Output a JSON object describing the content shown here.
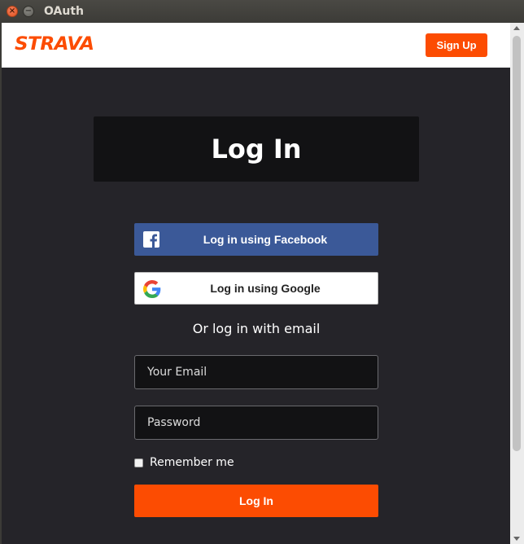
{
  "window": {
    "title": "OAuth",
    "close_glyph": "×",
    "minimize_glyph": "−"
  },
  "header": {
    "logo_text": "STRAVA",
    "signup_label": "Sign Up"
  },
  "main": {
    "heading": "Log In",
    "facebook_label": "Log in using Facebook",
    "google_label": "Log in using Google",
    "or_text": "Or log in with email",
    "email_placeholder": "Your Email",
    "password_placeholder": "Password",
    "remember_label": "Remember me",
    "login_label": "Log In"
  },
  "icons": {
    "facebook": "facebook-icon",
    "google": "google-icon"
  },
  "colors": {
    "brand_orange": "#fc4c02",
    "facebook_blue": "#3b5998",
    "page_background": "#252429"
  }
}
